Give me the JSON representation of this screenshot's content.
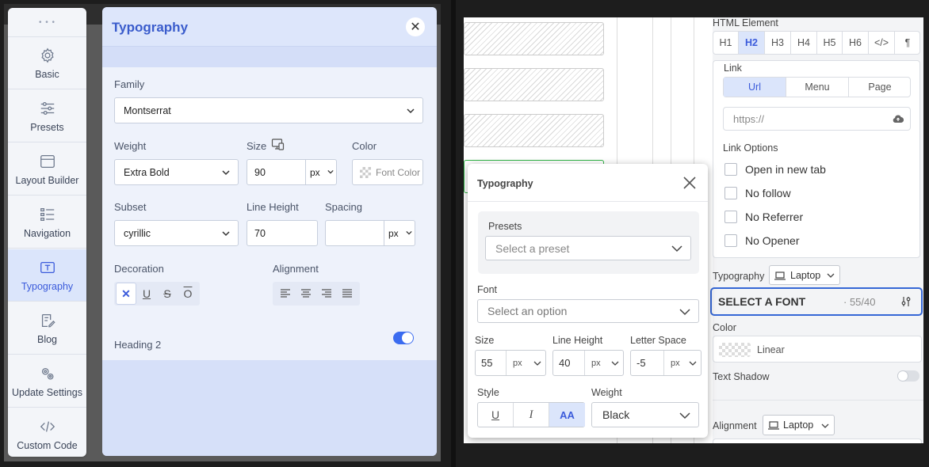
{
  "sidebar": {
    "items": [
      {
        "label": "Basic",
        "icon": "gear-icon"
      },
      {
        "label": "Presets",
        "icon": "sliders-icon"
      },
      {
        "label": "Layout Builder",
        "icon": "layout-icon"
      },
      {
        "label": "Navigation",
        "icon": "list-icon"
      },
      {
        "label": "Typography",
        "icon": "text-icon",
        "active": true
      },
      {
        "label": "Blog",
        "icon": "edit-icon"
      },
      {
        "label": "Update Settings",
        "icon": "cogs-icon"
      },
      {
        "label": "Custom Code",
        "icon": "code-icon"
      }
    ]
  },
  "typography_panel": {
    "title": "Typography",
    "family_label": "Family",
    "family_value": "Montserrat",
    "weight_label": "Weight",
    "weight_value": "Extra Bold",
    "size_label": "Size",
    "size_value": "90",
    "size_unit": "px",
    "color_label": "Color",
    "color_placeholder": "Font Color",
    "subset_label": "Subset",
    "subset_value": "cyrillic",
    "line_height_label": "Line Height",
    "line_height_value": "70",
    "spacing_label": "Spacing",
    "spacing_value": "",
    "spacing_unit": "px",
    "decoration_label": "Decoration",
    "decoration_options": [
      "✕",
      "U",
      "S",
      "O"
    ],
    "alignment_label": "Alignment",
    "heading_label": "Heading 2",
    "heading_enabled": true
  },
  "right_panel": {
    "html_element_label": "HTML Element",
    "html_elements": [
      "H1",
      "H2",
      "H3",
      "H4",
      "H5",
      "H6",
      "</>",
      "¶"
    ],
    "html_element_selected": "H2",
    "link_label": "Link",
    "link_tabs": [
      "Url",
      "Menu",
      "Page"
    ],
    "link_tab_selected": "Url",
    "url_placeholder": "https://",
    "link_options_label": "Link Options",
    "link_options": [
      "Open in new tab",
      "No follow",
      "No Referrer",
      "No Opener"
    ],
    "typography_label": "Typography",
    "device": "Laptop",
    "font_placeholder": "SELECT A FONT",
    "font_size_summary": "· 55/40",
    "color_label": "Color",
    "color_value": "Linear",
    "text_shadow_label": "Text Shadow",
    "alignment_label": "Alignment",
    "alignment_device": "Laptop"
  },
  "typography_popup": {
    "title": "Typography",
    "presets_label": "Presets",
    "preset_placeholder": "Select a preset",
    "font_label": "Font",
    "font_placeholder": "Select an option",
    "size_label": "Size",
    "size_value": "55",
    "size_unit": "px",
    "line_height_label": "Line Height",
    "line_height_value": "40",
    "line_height_unit": "px",
    "letter_space_label": "Letter Space",
    "letter_space_value": "-5",
    "letter_space_unit": "px",
    "style_label": "Style",
    "style_options": [
      "U",
      "I",
      "AA"
    ],
    "weight_label": "Weight",
    "weight_value": "Black"
  },
  "colors": {
    "accent": "#3b5bdb",
    "toggle_on": "#3b6cf0",
    "focus_border": "#3567d6",
    "green_outline": "#2fb344"
  }
}
